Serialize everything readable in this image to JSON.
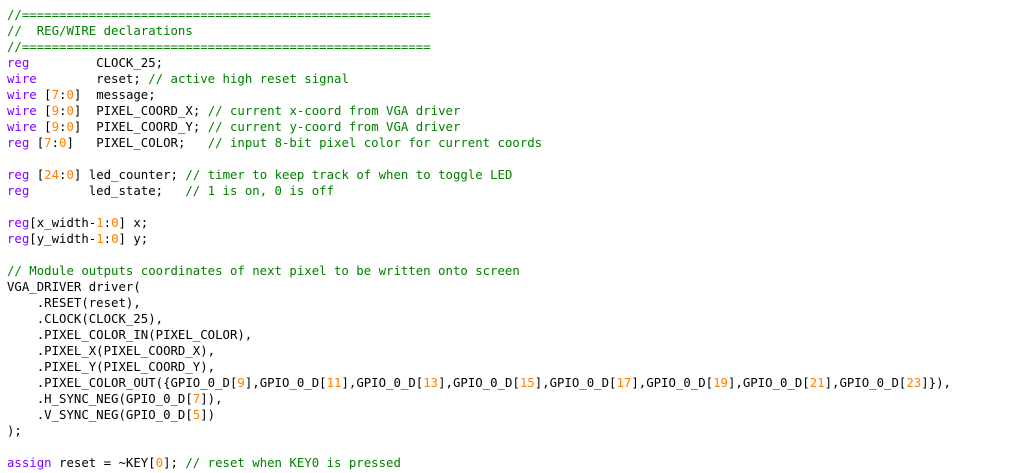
{
  "colors": {
    "text": "#000000",
    "comment": "#008000",
    "keyword": "#8000ff",
    "number": "#ff8000"
  },
  "code_lines": [
    [
      {
        "t": "comment",
        "v": "//======================================================="
      }
    ],
    [
      {
        "t": "comment",
        "v": "//  REG/WIRE declarations"
      }
    ],
    [
      {
        "t": "comment",
        "v": "//======================================================="
      }
    ],
    [
      {
        "t": "keyword",
        "v": "reg"
      },
      {
        "t": "text",
        "v": "         CLOCK_25;"
      }
    ],
    [
      {
        "t": "keyword",
        "v": "wire"
      },
      {
        "t": "text",
        "v": "        reset; "
      },
      {
        "t": "comment",
        "v": "// active high reset signal"
      }
    ],
    [
      {
        "t": "keyword",
        "v": "wire"
      },
      {
        "t": "text",
        "v": " ["
      },
      {
        "t": "number",
        "v": "7"
      },
      {
        "t": "text",
        "v": ":"
      },
      {
        "t": "number",
        "v": "0"
      },
      {
        "t": "text",
        "v": "]  message;"
      }
    ],
    [
      {
        "t": "keyword",
        "v": "wire"
      },
      {
        "t": "text",
        "v": " ["
      },
      {
        "t": "number",
        "v": "9"
      },
      {
        "t": "text",
        "v": ":"
      },
      {
        "t": "number",
        "v": "0"
      },
      {
        "t": "text",
        "v": "]  PIXEL_COORD_X; "
      },
      {
        "t": "comment",
        "v": "// current x-coord from VGA driver"
      }
    ],
    [
      {
        "t": "keyword",
        "v": "wire"
      },
      {
        "t": "text",
        "v": " ["
      },
      {
        "t": "number",
        "v": "9"
      },
      {
        "t": "text",
        "v": ":"
      },
      {
        "t": "number",
        "v": "0"
      },
      {
        "t": "text",
        "v": "]  PIXEL_COORD_Y; "
      },
      {
        "t": "comment",
        "v": "// current y-coord from VGA driver"
      }
    ],
    [
      {
        "t": "keyword",
        "v": "reg"
      },
      {
        "t": "text",
        "v": " ["
      },
      {
        "t": "number",
        "v": "7"
      },
      {
        "t": "text",
        "v": ":"
      },
      {
        "t": "number",
        "v": "0"
      },
      {
        "t": "text",
        "v": "]   PIXEL_COLOR;   "
      },
      {
        "t": "comment",
        "v": "// input 8-bit pixel color for current coords"
      }
    ],
    [],
    [
      {
        "t": "keyword",
        "v": "reg"
      },
      {
        "t": "text",
        "v": " ["
      },
      {
        "t": "number",
        "v": "24"
      },
      {
        "t": "text",
        "v": ":"
      },
      {
        "t": "number",
        "v": "0"
      },
      {
        "t": "text",
        "v": "] led_counter; "
      },
      {
        "t": "comment",
        "v": "// timer to keep track of when to toggle LED"
      }
    ],
    [
      {
        "t": "keyword",
        "v": "reg"
      },
      {
        "t": "text",
        "v": "        led_state;   "
      },
      {
        "t": "comment",
        "v": "// 1 is on, 0 is off"
      }
    ],
    [],
    [
      {
        "t": "keyword",
        "v": "reg"
      },
      {
        "t": "text",
        "v": "[x_width-"
      },
      {
        "t": "number",
        "v": "1"
      },
      {
        "t": "text",
        "v": ":"
      },
      {
        "t": "number",
        "v": "0"
      },
      {
        "t": "text",
        "v": "] x;"
      }
    ],
    [
      {
        "t": "keyword",
        "v": "reg"
      },
      {
        "t": "text",
        "v": "[y_width-"
      },
      {
        "t": "number",
        "v": "1"
      },
      {
        "t": "text",
        "v": ":"
      },
      {
        "t": "number",
        "v": "0"
      },
      {
        "t": "text",
        "v": "] y;"
      }
    ],
    [],
    [
      {
        "t": "comment",
        "v": "// Module outputs coordinates of next pixel to be written onto screen"
      }
    ],
    [
      {
        "t": "text",
        "v": "VGA_DRIVER driver("
      }
    ],
    [
      {
        "t": "text",
        "v": "    .RESET(reset),"
      }
    ],
    [
      {
        "t": "text",
        "v": "    .CLOCK(CLOCK_25),"
      }
    ],
    [
      {
        "t": "text",
        "v": "    .PIXEL_COLOR_IN(PIXEL_COLOR),"
      }
    ],
    [
      {
        "t": "text",
        "v": "    .PIXEL_X(PIXEL_COORD_X),"
      }
    ],
    [
      {
        "t": "text",
        "v": "    .PIXEL_Y(PIXEL_COORD_Y),"
      }
    ],
    [
      {
        "t": "text",
        "v": "    .PIXEL_COLOR_OUT({GPIO_0_D["
      },
      {
        "t": "number",
        "v": "9"
      },
      {
        "t": "text",
        "v": "],GPIO_0_D["
      },
      {
        "t": "number",
        "v": "11"
      },
      {
        "t": "text",
        "v": "],GPIO_0_D["
      },
      {
        "t": "number",
        "v": "13"
      },
      {
        "t": "text",
        "v": "],GPIO_0_D["
      },
      {
        "t": "number",
        "v": "15"
      },
      {
        "t": "text",
        "v": "],GPIO_0_D["
      },
      {
        "t": "number",
        "v": "17"
      },
      {
        "t": "text",
        "v": "],GPIO_0_D["
      },
      {
        "t": "number",
        "v": "19"
      },
      {
        "t": "text",
        "v": "],GPIO_0_D["
      },
      {
        "t": "number",
        "v": "21"
      },
      {
        "t": "text",
        "v": "],GPIO_0_D["
      },
      {
        "t": "number",
        "v": "23"
      },
      {
        "t": "text",
        "v": "]}),"
      }
    ],
    [
      {
        "t": "text",
        "v": "    .H_SYNC_NEG(GPIO_0_D["
      },
      {
        "t": "number",
        "v": "7"
      },
      {
        "t": "text",
        "v": "]),"
      }
    ],
    [
      {
        "t": "text",
        "v": "    .V_SYNC_NEG(GPIO_0_D["
      },
      {
        "t": "number",
        "v": "5"
      },
      {
        "t": "text",
        "v": "])"
      }
    ],
    [
      {
        "t": "text",
        "v": ");"
      }
    ],
    [],
    [
      {
        "t": "keyword",
        "v": "assign"
      },
      {
        "t": "text",
        "v": " reset = ~KEY["
      },
      {
        "t": "number",
        "v": "0"
      },
      {
        "t": "text",
        "v": "]; "
      },
      {
        "t": "comment",
        "v": "// reset when KEY0 is pressed"
      }
    ]
  ]
}
